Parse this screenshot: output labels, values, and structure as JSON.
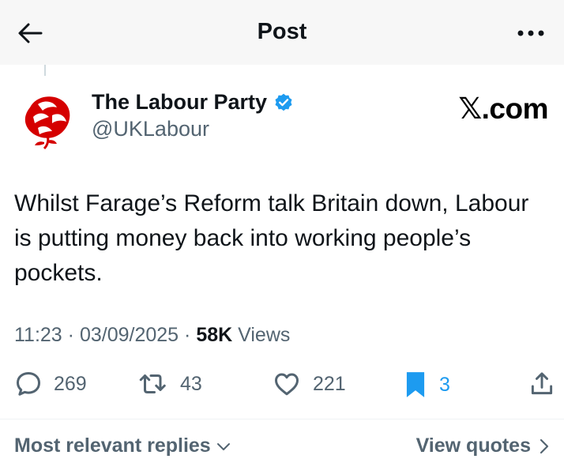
{
  "header": {
    "title": "Post"
  },
  "author": {
    "name": "The Labour Party",
    "handle": "@UKLabour"
  },
  "watermark": "𝕏.com",
  "post": {
    "text": "Whilst Farage’s Reform talk Britain down, Labour is putting money back into working people’s pockets.",
    "time": "11:23",
    "date": "03/09/2025",
    "views_count": "58K",
    "views_label": "Views"
  },
  "actions": {
    "replies": "269",
    "reposts": "43",
    "likes": "221",
    "bookmarks": "3"
  },
  "footer": {
    "sort_label": "Most relevant replies",
    "quotes_label": "View quotes"
  },
  "colors": {
    "accent": "#1d9bf0",
    "labour_red": "#d50000",
    "muted": "#536471"
  }
}
